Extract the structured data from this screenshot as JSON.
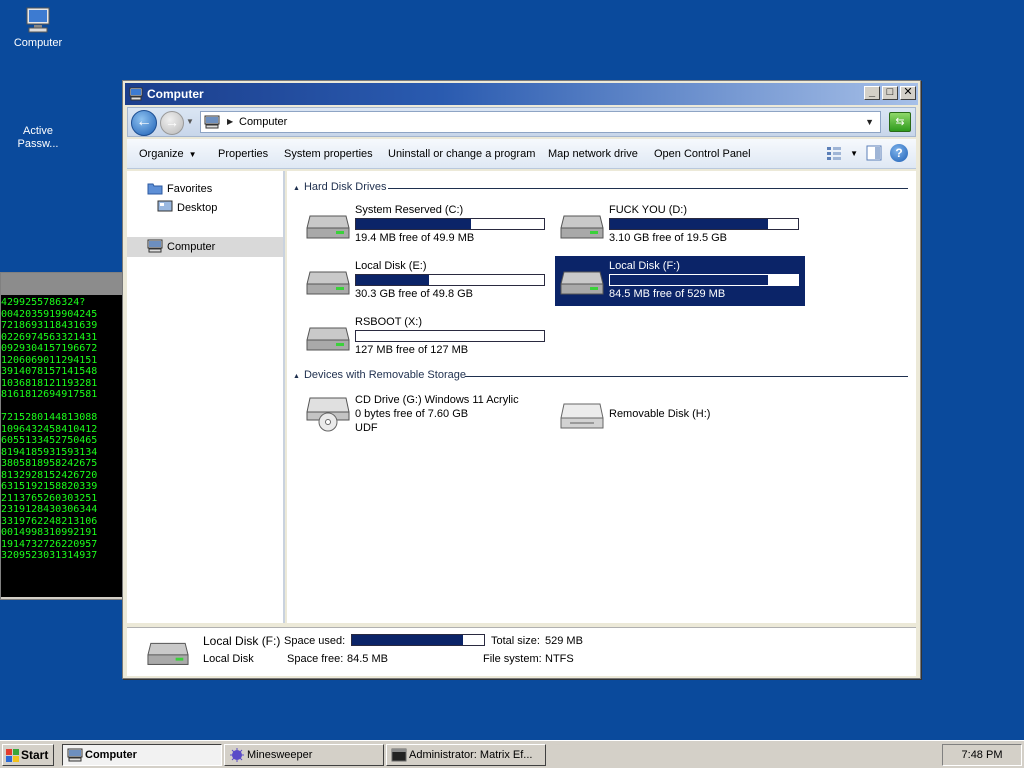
{
  "desktop": {
    "icons": [
      {
        "label": "Computer"
      },
      {
        "label_line1": "Active",
        "label_line2": "Passw..."
      }
    ]
  },
  "matrix_text": "4299255786324?\n0042035919904245\n7218693118431639\n0226974563321431\n0929304157196672\n1206069011294151\n3914078157141548\n1036818121193281\n8161812694917581\n\n7215280144813088\n1096432458410412\n6055133452750465\n8194185931593134\n3805818958242675\n8132928152426720\n6315192158820339\n2113765260303251\n2319128430306344\n3319762248213106\n0014998310992191\n1914732726220957\n3209523031314937",
  "window": {
    "title": "Computer",
    "buttons": {
      "minimize": "_",
      "maximize": "□",
      "close": "✕"
    },
    "address": {
      "location": "Computer"
    },
    "commands": {
      "organize": "Organize",
      "properties": "Properties",
      "system_properties": "System properties",
      "uninstall": "Uninstall or change a program",
      "map_drive": "Map network drive",
      "control_panel": "Open Control Panel"
    },
    "nav": {
      "favorites": "Favorites",
      "desktop": "Desktop",
      "computer": "Computer"
    },
    "groups": {
      "hard_disks": "Hard Disk Drives",
      "removable": "Devices with Removable Storage"
    },
    "drives": [
      {
        "name": "System Reserved (C:)",
        "free": "19.4 MB free of 49.9 MB",
        "used_fraction": 0.61
      },
      {
        "name": "FUCK YOU (D:)",
        "free": "3.10 GB free of 19.5 GB",
        "used_fraction": 0.84
      },
      {
        "name": "Local Disk (E:)",
        "free": "30.3 GB free of 49.8 GB",
        "used_fraction": 0.39
      },
      {
        "name": "Local Disk (F:)",
        "free": "84.5 MB free of 529 MB",
        "used_fraction": 0.84
      },
      {
        "name": "RSBOOT (X:)",
        "free": "127 MB free of 127 MB",
        "used_fraction": 0.0
      }
    ],
    "removable": [
      {
        "name": "CD Drive (G:) Windows 11 Acrylic",
        "free": "0 bytes free of 7.60 GB",
        "fs": "UDF"
      },
      {
        "name": "Removable Disk (H:)"
      }
    ],
    "details": {
      "name": "Local Disk (F:)",
      "type": "Local Disk",
      "space_used_label": "Space used:",
      "space_used_fraction": 0.84,
      "space_free_label": "Space free:",
      "space_free": "84.5 MB",
      "total_size_label": "Total size:",
      "total_size": "529 MB",
      "fs_label": "File system:",
      "fs": "NTFS"
    }
  },
  "taskbar": {
    "start": "Start",
    "tasks": [
      "Computer",
      "Minesweeper",
      "Administrator:  Matrix Ef..."
    ],
    "clock": "7:48 PM"
  }
}
